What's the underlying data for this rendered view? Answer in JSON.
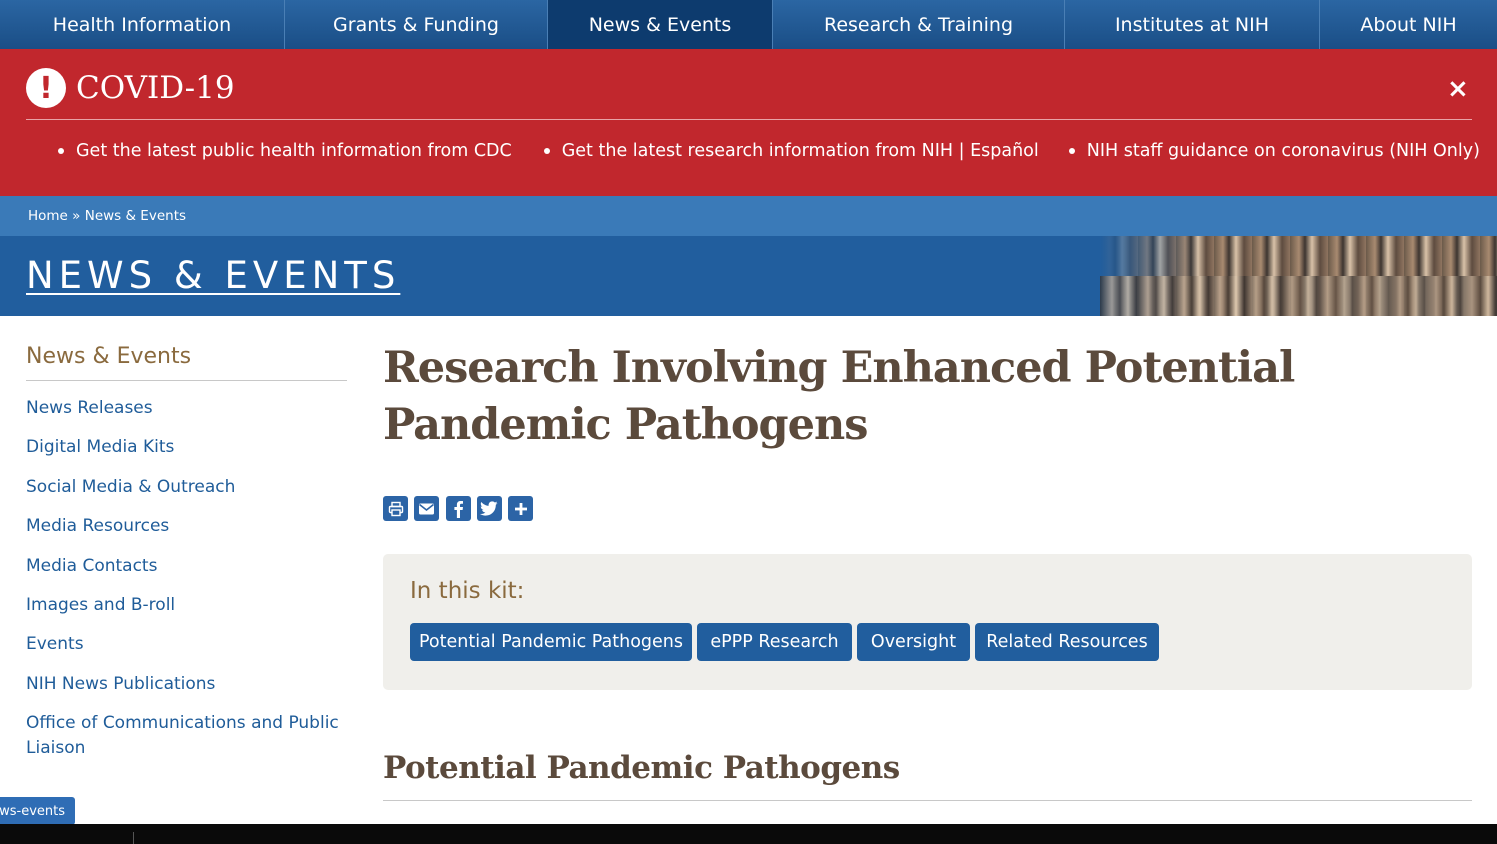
{
  "topnav": {
    "items": [
      {
        "label": "Health Information"
      },
      {
        "label": "Grants & Funding"
      },
      {
        "label": "News & Events",
        "active": true
      },
      {
        "label": "Research & Training"
      },
      {
        "label": "Institutes at NIH"
      },
      {
        "label": "About NIH"
      }
    ]
  },
  "covid": {
    "icon": "alert-circle-icon",
    "title": "COVID-19",
    "close": "×",
    "links": [
      "Get the latest public health information from CDC",
      "Get the latest research information from NIH | Español",
      "NIH staff guidance on coronavirus (NIH Only)"
    ]
  },
  "breadcrumb": {
    "home": "Home",
    "separator": " » ",
    "current": "News & Events"
  },
  "section": {
    "title": "NEWS & EVENTS"
  },
  "sidebar": {
    "heading": "News & Events",
    "items": [
      "News Releases",
      "Digital Media Kits",
      "Social Media & Outreach",
      "Media Resources",
      "Media Contacts",
      "Images and B-roll",
      "Events",
      "NIH News Publications",
      "Office of Communications and Public Liaison"
    ]
  },
  "main": {
    "title": "Research Involving Enhanced Potential Pandemic Pathogens",
    "share_icons": [
      "print-icon",
      "email-icon",
      "facebook-icon",
      "twitter-icon",
      "plus-icon"
    ],
    "kit": {
      "label": "In this kit:",
      "buttons": [
        "Potential Pandemic Pathogens",
        "ePPP Research",
        "Oversight",
        "Related Resources"
      ]
    },
    "subheading": "Potential Pandemic Pathogens"
  },
  "tag": {
    "text": "ws-events"
  },
  "colors": {
    "nav": "#1a4e86",
    "covid_red": "#c1272d",
    "breadcrumb_blue": "#3a7ab8",
    "banner_blue": "#215e9e",
    "link_blue": "#1f5c99",
    "heading_brown": "#8a6a3e",
    "title_brown": "#5b4a3c"
  }
}
